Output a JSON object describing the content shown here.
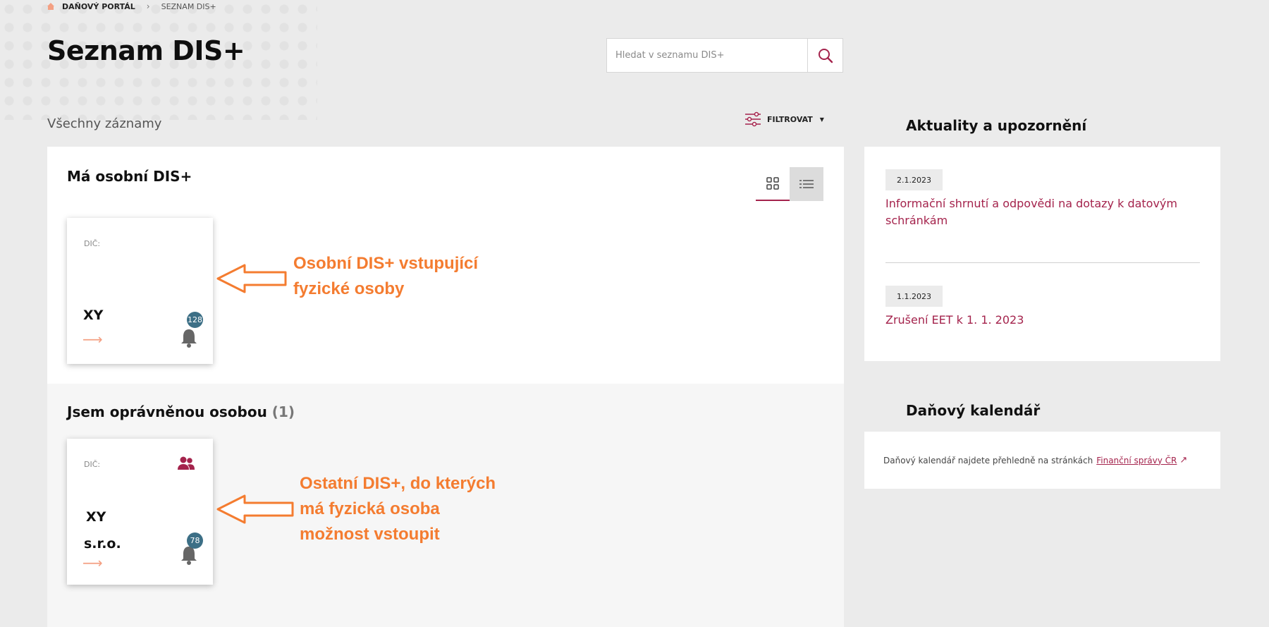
{
  "breadcrumb": {
    "home": "DAŇOVÝ PORTÁL",
    "current": "SEZNAM DIS+"
  },
  "page": {
    "title": "Seznam DIS+"
  },
  "search": {
    "placeholder": "Hledat v seznamu DIS+"
  },
  "list": {
    "all_records": "Všechny záznamy",
    "filter_label": "FILTROVAT"
  },
  "personal": {
    "title": "Má osobní DIS+",
    "card": {
      "dic_label": "DIČ:",
      "name": "XY",
      "notifications": "128"
    }
  },
  "authorized": {
    "title": "Jsem oprávněnou osobou",
    "count": "(1)",
    "card": {
      "dic_label": "DIČ:",
      "name_line1": "XY",
      "name_line2": "s.r.o.",
      "notifications": "78"
    }
  },
  "annotations": {
    "first": [
      "Osobní DIS+ vstupující",
      "fyzické osoby"
    ],
    "second": [
      "Ostatní DIS+, do kterých",
      "má fyzická osoba",
      "možnost vstoupit"
    ]
  },
  "news": {
    "heading": "Aktuality a upozornění",
    "items": [
      {
        "date": "2.1.2023",
        "text": "Informační shrnutí a odpovědi na dotazy k datovým schránkám"
      },
      {
        "date": "1.1.2023",
        "text": "Zrušení EET k 1. 1. 2023"
      }
    ]
  },
  "calendar": {
    "heading": "Daňový kalendář",
    "text": "Daňový kalendář najdete přehledně na stránkách",
    "link": "Finanční správy ČR"
  },
  "colors": {
    "accent": "#a4234c",
    "annotation": "#f47c30",
    "badge": "#3c6f86"
  }
}
